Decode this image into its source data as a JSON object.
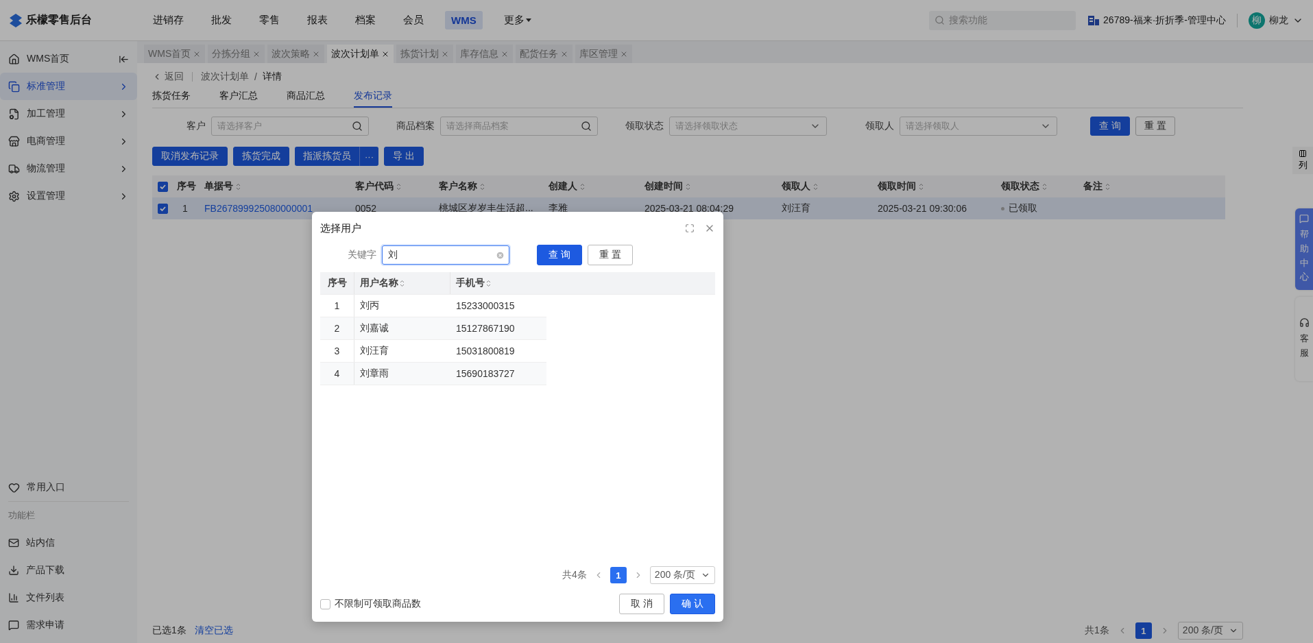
{
  "app": {
    "name": "乐檬零售后台"
  },
  "top_nav": [
    {
      "label": "进销存",
      "selected": false
    },
    {
      "label": "批发",
      "selected": false
    },
    {
      "label": "零售",
      "selected": false
    },
    {
      "label": "报表",
      "selected": false
    },
    {
      "label": "档案",
      "selected": false
    },
    {
      "label": "会员",
      "selected": false
    },
    {
      "label": "WMS",
      "selected": true
    },
    {
      "label": "更多",
      "selected": false,
      "dropdown": true
    }
  ],
  "search": {
    "placeholder": "搜索功能"
  },
  "store": "26789-福来·折折季-管理中心",
  "user": {
    "avatar": "柳",
    "name": "柳龙"
  },
  "sidebar": {
    "items": [
      {
        "label": "WMS首页",
        "kind": "home",
        "selected": false
      },
      {
        "label": "标准管理",
        "kind": "copy",
        "selected": true
      },
      {
        "label": "加工管理",
        "kind": "doc",
        "selected": false
      },
      {
        "label": "电商管理",
        "kind": "shop",
        "selected": false
      },
      {
        "label": "物流管理",
        "kind": "truck",
        "selected": false
      },
      {
        "label": "设置管理",
        "kind": "gear",
        "selected": false
      }
    ],
    "favorites": "常用入口",
    "section": "功能栏",
    "tools": [
      {
        "label": "站内信",
        "kind": "mail"
      },
      {
        "label": "产品下载",
        "kind": "download"
      },
      {
        "label": "文件列表",
        "kind": "chart"
      },
      {
        "label": "需求申请",
        "kind": "chat"
      }
    ]
  },
  "page_tabs": [
    {
      "label": "WMS首页",
      "selected": false
    },
    {
      "label": "分拣分组",
      "selected": false
    },
    {
      "label": "波次策略",
      "selected": false
    },
    {
      "label": "波次计划单",
      "selected": true
    },
    {
      "label": "拣货计划",
      "selected": false
    },
    {
      "label": "库存信息",
      "selected": false
    },
    {
      "label": "配货任务",
      "selected": false
    },
    {
      "label": "库区管理",
      "selected": false
    }
  ],
  "breadcrumb": {
    "back": "返回",
    "parent": "波次计划单",
    "separator": "/",
    "current": "详情"
  },
  "sub_tabs": [
    {
      "label": "拣货任务",
      "selected": false
    },
    {
      "label": "客户汇总",
      "selected": false
    },
    {
      "label": "商品汇总",
      "selected": false
    },
    {
      "label": "发布记录",
      "selected": true
    }
  ],
  "filters": [
    {
      "label": "客户",
      "placeholder": "请选择客户",
      "kind": "search"
    },
    {
      "label": "商品档案",
      "placeholder": "请选择商品档案",
      "kind": "search"
    },
    {
      "label": "领取状态",
      "placeholder": "请选择领取状态",
      "kind": "select"
    },
    {
      "label": "领取人",
      "placeholder": "请选择领取人",
      "kind": "select"
    }
  ],
  "filter_buttons": [
    {
      "label": "查 询",
      "kind": "primary"
    },
    {
      "label": "重 置",
      "kind": "default"
    }
  ],
  "actions": [
    {
      "label": "取消发布记录",
      "kind": "plain"
    },
    {
      "label": "拣货完成",
      "kind": "plain"
    },
    {
      "label": "指派拣货员",
      "kind": "split",
      "more": "···"
    },
    {
      "label": "导 出",
      "kind": "plain"
    }
  ],
  "table": {
    "all_checked": true,
    "columns": [
      {
        "label": "序号",
        "sortable": false
      },
      {
        "label": "单据号",
        "sortable": true
      },
      {
        "label": "客户代码",
        "sortable": true
      },
      {
        "label": "客户名称",
        "sortable": true
      },
      {
        "label": "创建人",
        "sortable": true
      },
      {
        "label": "创建时间",
        "sortable": true
      },
      {
        "label": "领取人",
        "sortable": true
      },
      {
        "label": "领取时间",
        "sortable": true
      },
      {
        "label": "领取状态",
        "sortable": true
      },
      {
        "label": "备注",
        "sortable": true
      }
    ],
    "rows": [
      {
        "checked": true,
        "cells": [
          "1",
          "FB267899925080000001",
          "0052",
          "桃城区岁岁丰生活超...",
          "李雅",
          "2025-03-21 08:04:29",
          "刘汪育",
          "2025-03-21 09:30:06",
          "已领取",
          ""
        ]
      }
    ]
  },
  "column_settings": "列",
  "footer": {
    "selected_count": "已选1条",
    "clear": "清空已选",
    "total": "共1条",
    "page": "1",
    "page_size": "200 条/页"
  },
  "side_widgets": [
    {
      "label": "帮助中心",
      "kind": "help"
    },
    {
      "label": "客服",
      "kind": "service"
    }
  ],
  "dialog": {
    "title": "选择用户",
    "keyword_label": "关键字",
    "keyword": "刘",
    "buttons": [
      {
        "label": "查 询",
        "kind": "primary"
      },
      {
        "label": "重 置",
        "kind": "default"
      }
    ],
    "columns": [
      {
        "label": "序号",
        "sortable": false
      },
      {
        "label": "用户名称",
        "sortable": true
      },
      {
        "label": "手机号",
        "sortable": true
      }
    ],
    "rows": [
      [
        "1",
        "刘丙",
        "15233000315"
      ],
      [
        "2",
        "刘嘉诚",
        "15127867190"
      ],
      [
        "3",
        "刘汪育",
        "15031800819"
      ],
      [
        "4",
        "刘章雨",
        "15690183727"
      ]
    ],
    "total": "共4条",
    "page": "1",
    "page_size": "200 条/页",
    "unlimited": {
      "label": "不限制可领取商品数",
      "checked": false
    },
    "footer_buttons": [
      {
        "label": "取 消",
        "kind": "default"
      },
      {
        "label": "确 认",
        "kind": "primary"
      }
    ]
  }
}
